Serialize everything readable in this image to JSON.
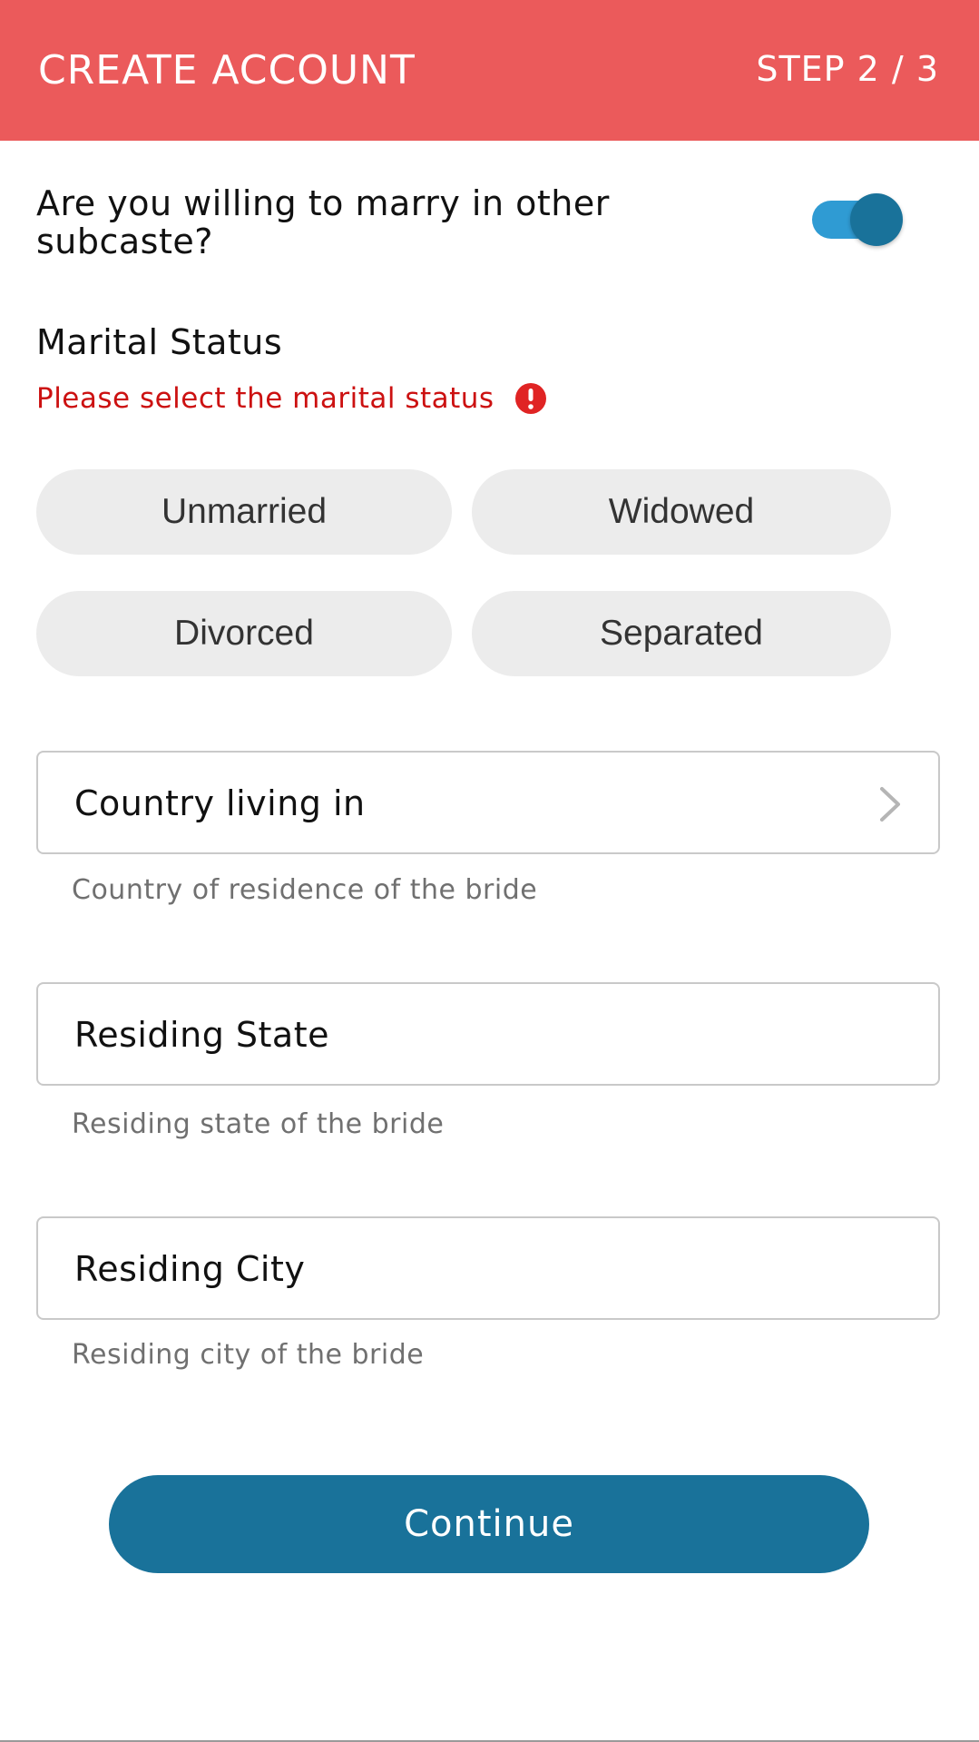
{
  "header": {
    "title": "CREATE ACCOUNT",
    "step": "STEP 2 / 3",
    "background_color": "#EB5A5B"
  },
  "subcaste_question": {
    "label": "Are you willing to marry in other subcaste?",
    "toggle_on": true,
    "toggle_color": "#19729A"
  },
  "marital_status": {
    "label": "Marital Status",
    "error_text": "Please select the marital status",
    "error_icon": "exclamation-circle-icon",
    "options": [
      "Unmarried",
      "Widowed",
      "Divorced",
      "Separated"
    ]
  },
  "fields": {
    "country": {
      "label": "Country living in",
      "helper": "Country of residence of the bride",
      "icon": "chevron-right-icon"
    },
    "state": {
      "label": "Residing State",
      "helper": "Residing state of the bride"
    },
    "city": {
      "label": "Residing City",
      "helper": "Residing city of the bride"
    }
  },
  "continue_button": {
    "label": "Continue",
    "color": "#19729A"
  }
}
